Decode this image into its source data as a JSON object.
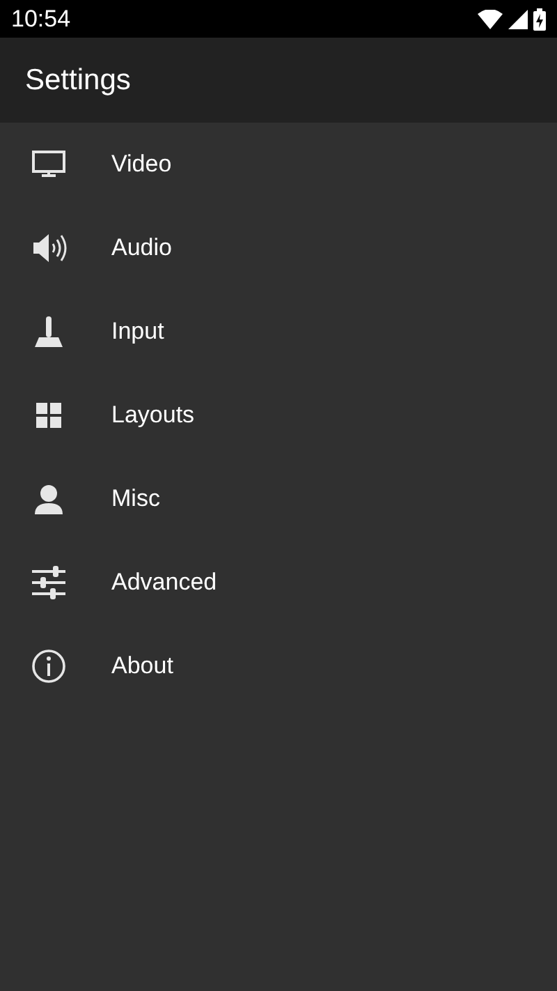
{
  "status_bar": {
    "time": "10:54"
  },
  "app_bar": {
    "title": "Settings"
  },
  "menu": [
    {
      "kind": "video",
      "label": "Video"
    },
    {
      "kind": "audio",
      "label": "Audio"
    },
    {
      "kind": "input",
      "label": "Input"
    },
    {
      "kind": "layouts",
      "label": "Layouts"
    },
    {
      "kind": "misc",
      "label": "Misc"
    },
    {
      "kind": "advanced",
      "label": "Advanced"
    },
    {
      "kind": "about",
      "label": "About"
    }
  ]
}
